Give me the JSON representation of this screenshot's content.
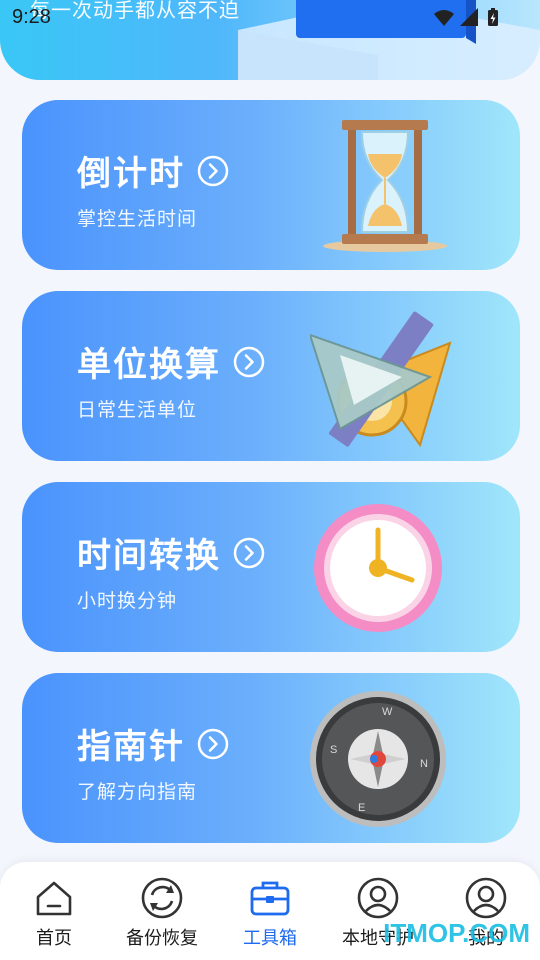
{
  "status_bar": {
    "time": "9:28",
    "icons": [
      "wifi-icon",
      "signal-icon",
      "battery-charging-icon"
    ]
  },
  "header": {
    "slogan": "每一次动手都从容不迫"
  },
  "cards": [
    {
      "title": "倒计时",
      "subtitle": "掌控生活时间",
      "icon": "hourglass-icon"
    },
    {
      "title": "单位换算",
      "subtitle": "日常生活单位",
      "icon": "ruler-triangle-icon"
    },
    {
      "title": "时间转换",
      "subtitle": "小时换分钟",
      "icon": "clock-icon"
    },
    {
      "title": "指南针",
      "subtitle": "了解方向指南",
      "icon": "compass-icon"
    }
  ],
  "compass_letters": {
    "n": "N",
    "s": "S",
    "e": "E",
    "w": "W"
  },
  "bottom_nav": {
    "items": [
      {
        "label": "首页",
        "icon": "home-icon"
      },
      {
        "label": "备份恢复",
        "icon": "refresh-icon"
      },
      {
        "label": "工具箱",
        "icon": "toolbox-icon",
        "active": true
      },
      {
        "label": "本地守护",
        "icon": "user-circle-icon"
      },
      {
        "label": "我的",
        "icon": "profile-icon"
      }
    ]
  },
  "watermark": "ITMOP.COM",
  "colors": {
    "accent": "#1e6bf0",
    "card_start": "#4a93fd",
    "card_end": "#a0e6fb",
    "watermark": "#19bde3"
  }
}
